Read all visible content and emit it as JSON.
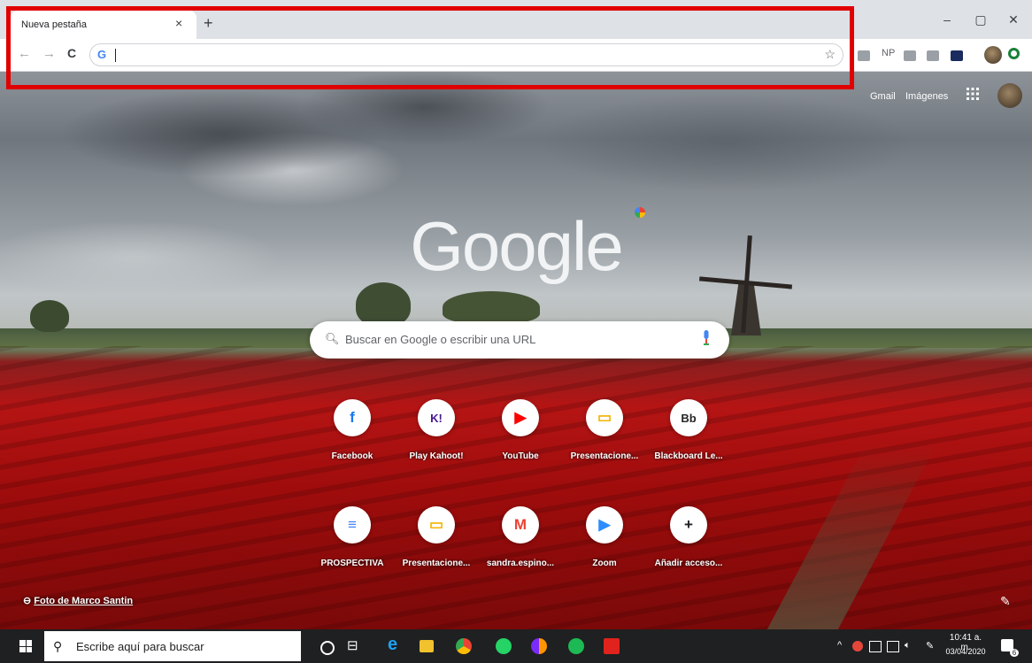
{
  "browser": {
    "tab_title": "Nueva pestaña",
    "tab_close": "×",
    "new_tab": "+",
    "window": {
      "minimize": "–",
      "maximize": "▢",
      "close": "✕"
    },
    "nav": {
      "back": "←",
      "forward": "→",
      "reload": "C"
    },
    "omnibox": {
      "favicon": "G",
      "value": "",
      "star": "☆"
    },
    "extensions": {
      "np_label": "NP"
    }
  },
  "ntp": {
    "header": {
      "gmail": "Gmail",
      "images": "Imágenes"
    },
    "logo": "Google",
    "search": {
      "placeholder": "Buscar en Google o escribir una URL"
    },
    "shortcuts": [
      {
        "label": "Facebook",
        "icon": "facebook-icon",
        "glyph": "f",
        "color": "#1877f2"
      },
      {
        "label": "Play Kahoot!",
        "icon": "kahoot-icon",
        "glyph": "K!",
        "color": "#46178f"
      },
      {
        "label": "YouTube",
        "icon": "youtube-icon",
        "glyph": "▶",
        "color": "#ff0000"
      },
      {
        "label": "Presentacione...",
        "icon": "slides-icon",
        "glyph": "▭",
        "color": "#f4b400"
      },
      {
        "label": "Blackboard Le...",
        "icon": "blackboard-icon",
        "glyph": "Bb",
        "color": "#262626"
      },
      {
        "label": "PROSPECTIVA",
        "icon": "docs-icon",
        "glyph": "≡",
        "color": "#4285f4"
      },
      {
        "label": "Presentacione...",
        "icon": "slides-icon",
        "glyph": "▭",
        "color": "#f4b400"
      },
      {
        "label": "sandra.espino...",
        "icon": "gmail-icon",
        "glyph": "M",
        "color": "#ea4335"
      },
      {
        "label": "Zoom",
        "icon": "zoom-icon",
        "glyph": "▶",
        "color": "#2d8cff"
      },
      {
        "label": "Añadir acceso...",
        "icon": "add-icon",
        "glyph": "+",
        "color": "#202124"
      }
    ],
    "photo_credit": {
      "prefix": "⊖",
      "text": "Foto de Marco Santin"
    },
    "edit": "✎"
  },
  "taskbar": {
    "search_placeholder": "Escribe aquí para buscar",
    "time": "10:41 a. m.",
    "date": "03/04/2020",
    "tray_caret": "^",
    "notification_count": "6"
  }
}
